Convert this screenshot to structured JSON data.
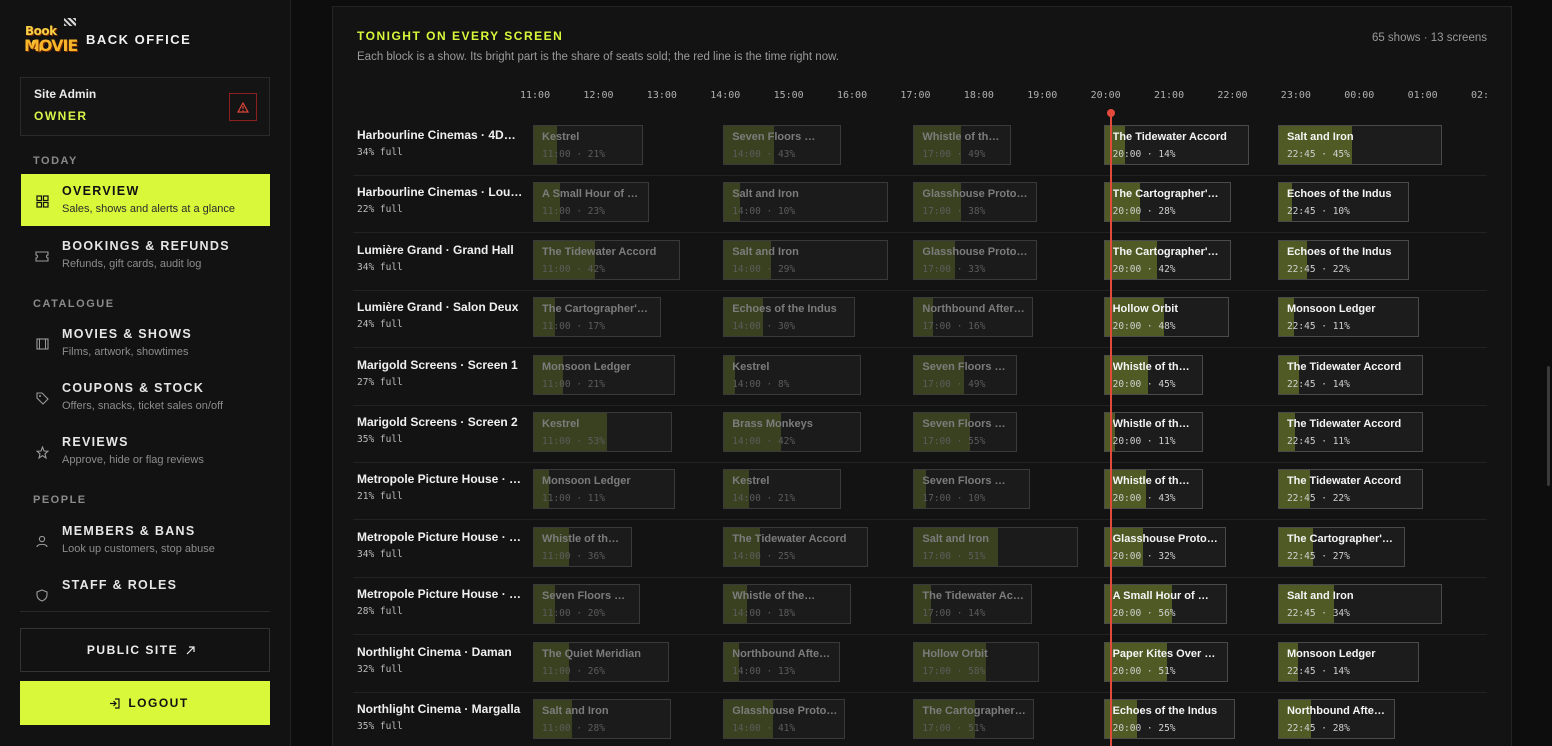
{
  "sidebar": {
    "logo_lines": [
      "Book My",
      "MOVIE"
    ],
    "brand_title": "BACK OFFICE",
    "admin": {
      "name": "Site Admin",
      "role": "OWNER",
      "alert_icon": "warning-triangle-icon"
    },
    "sections": {
      "today": "TODAY",
      "catalogue": "CATALOGUE",
      "people": "PEOPLE"
    },
    "nav": {
      "overview": {
        "title": "OVERVIEW",
        "sub": "Sales, shows and alerts at a glance",
        "icon": "grid-icon"
      },
      "bookings": {
        "title": "BOOKINGS & REFUNDS",
        "sub": "Refunds, gift cards, audit log",
        "icon": "ticket-icon"
      },
      "movies": {
        "title": "MOVIES & SHOWS",
        "sub": "Films, artwork, showtimes",
        "icon": "film-icon"
      },
      "coupons": {
        "title": "COUPONS & STOCK",
        "sub": "Offers, snacks, ticket sales on/off",
        "icon": "tag-icon"
      },
      "reviews": {
        "title": "REVIEWS",
        "sub": "Approve, hide or flag reviews",
        "icon": "star-icon"
      },
      "members": {
        "title": "MEMBERS & BANS",
        "sub": "Look up customers, stop abuse",
        "icon": "user-icon"
      },
      "staff": {
        "title": "STAFF & ROLES",
        "icon": "shield-icon"
      }
    },
    "public_site": "PUBLIC SITE",
    "logout": "LOGOUT"
  },
  "panel": {
    "title": "TONIGHT ON EVERY SCREEN",
    "subtitle": "Each block is a show. Its bright part is the share of seats sold; the red line is the time right now.",
    "stats": "65 shows · 13 screens",
    "ticks": [
      "11:00",
      "12:00",
      "13:00",
      "14:00",
      "15:00",
      "16:00",
      "17:00",
      "18:00",
      "19:00",
      "20:00",
      "21:00",
      "22:00",
      "23:00",
      "00:00",
      "01:00",
      "02:"
    ],
    "now_time": "20:00",
    "colors": {
      "accent": "#d9f83a",
      "now_line": "#e24a3b",
      "sold_fill": "#4f5a24"
    },
    "rows": [
      {
        "venue": "Harbourline Cinemas · 4DX …",
        "fill": "34% full",
        "shows": [
          {
            "title": "Kestrel",
            "meta": "11:00 · 21%",
            "sold": 21
          },
          {
            "title": "Seven Floors …",
            "meta": "14:00 · 43%",
            "sold": 43
          },
          {
            "title": "Whistle of the…",
            "meta": "17:00 · 49%",
            "sold": 49
          },
          {
            "title": "The Tidewater Accord",
            "meta": "20:00 · 14%",
            "sold": 14
          },
          {
            "title": "Salt and Iron",
            "meta": "22:45 · 45%",
            "sold": 45
          }
        ]
      },
      {
        "venue": "Harbourline Cinemas · Lou…",
        "fill": "22% full",
        "shows": [
          {
            "title": "A Small Hour of …",
            "meta": "11:00 · 23%",
            "sold": 23
          },
          {
            "title": "Salt and Iron",
            "meta": "14:00 · 10%",
            "sold": 10
          },
          {
            "title": "Glasshouse Proto…",
            "meta": "17:00 · 38%",
            "sold": 38
          },
          {
            "title": "The Cartographer's…",
            "meta": "20:00 · 28%",
            "sold": 28
          },
          {
            "title": "Echoes of the Indus",
            "meta": "22:45 · 10%",
            "sold": 10
          }
        ]
      },
      {
        "venue": "Lumière Grand · Grand Hall",
        "fill": "34% full",
        "shows": [
          {
            "title": "The Tidewater Accord",
            "meta": "11:00 · 42%",
            "sold": 42
          },
          {
            "title": "Salt and Iron",
            "meta": "14:00 · 29%",
            "sold": 29
          },
          {
            "title": "Glasshouse Proto…",
            "meta": "17:00 · 33%",
            "sold": 33
          },
          {
            "title": "The Cartographer's…",
            "meta": "20:00 · 42%",
            "sold": 42
          },
          {
            "title": "Echoes of the Indus",
            "meta": "22:45 · 22%",
            "sold": 22
          }
        ]
      },
      {
        "venue": "Lumière Grand · Salon Deux",
        "fill": "24% full",
        "shows": [
          {
            "title": "The Cartographer's…",
            "meta": "11:00 · 17%",
            "sold": 17
          },
          {
            "title": "Echoes of the Indus",
            "meta": "14:00 · 30%",
            "sold": 30
          },
          {
            "title": "Northbound After…",
            "meta": "17:00 · 16%",
            "sold": 16
          },
          {
            "title": "Hollow Orbit",
            "meta": "20:00 · 48%",
            "sold": 48
          },
          {
            "title": "Monsoon Ledger",
            "meta": "22:45 · 11%",
            "sold": 11
          }
        ]
      },
      {
        "venue": "Marigold Screens · Screen 1",
        "fill": "27% full",
        "shows": [
          {
            "title": "Monsoon Ledger",
            "meta": "11:00 · 21%",
            "sold": 21
          },
          {
            "title": "Kestrel",
            "meta": "14:00 · 8%",
            "sold": 8
          },
          {
            "title": "Seven Floors …",
            "meta": "17:00 · 49%",
            "sold": 49
          },
          {
            "title": "Whistle of the…",
            "meta": "20:00 · 45%",
            "sold": 45
          },
          {
            "title": "The Tidewater Accord",
            "meta": "22:45 · 14%",
            "sold": 14
          }
        ]
      },
      {
        "venue": "Marigold Screens · Screen 2",
        "fill": "35% full",
        "shows": [
          {
            "title": "Kestrel",
            "meta": "11:00 · 53%",
            "sold": 53
          },
          {
            "title": "Brass Monkeys",
            "meta": "14:00 · 42%",
            "sold": 42
          },
          {
            "title": "Seven Floors …",
            "meta": "17:00 · 55%",
            "sold": 55
          },
          {
            "title": "Whistle of the…",
            "meta": "20:00 · 11%",
            "sold": 11
          },
          {
            "title": "The Tidewater Accord",
            "meta": "22:45 · 11%",
            "sold": 11
          }
        ]
      },
      {
        "venue": "Metropole Picture House · …",
        "fill": "21% full",
        "shows": [
          {
            "title": "Monsoon Ledger",
            "meta": "11:00 · 11%",
            "sold": 11
          },
          {
            "title": "Kestrel",
            "meta": "14:00 · 21%",
            "sold": 21
          },
          {
            "title": "Seven Floors …",
            "meta": "17:00 · 10%",
            "sold": 10
          },
          {
            "title": "Whistle of the…",
            "meta": "20:00 · 43%",
            "sold": 43
          },
          {
            "title": "The Tidewater Accord",
            "meta": "22:45 · 22%",
            "sold": 22
          }
        ]
      },
      {
        "venue": "Metropole Picture House · …",
        "fill": "34% full",
        "shows": [
          {
            "title": "Whistle of the…",
            "meta": "11:00 · 36%",
            "sold": 36
          },
          {
            "title": "The Tidewater Accord",
            "meta": "14:00 · 25%",
            "sold": 25
          },
          {
            "title": "Salt and Iron",
            "meta": "17:00 · 51%",
            "sold": 51
          },
          {
            "title": "Glasshouse Proto…",
            "meta": "20:00 · 32%",
            "sold": 32
          },
          {
            "title": "The Cartographer's…",
            "meta": "22:45 · 27%",
            "sold": 27
          }
        ]
      },
      {
        "venue": "Metropole Picture House · …",
        "fill": "28% full",
        "shows": [
          {
            "title": "Seven Floors …",
            "meta": "11:00 · 20%",
            "sold": 20
          },
          {
            "title": "Whistle of the…",
            "meta": "14:00 · 18%",
            "sold": 18
          },
          {
            "title": "The Tidewater Accord",
            "meta": "17:00 · 14%",
            "sold": 14
          },
          {
            "title": "A Small Hour of …",
            "meta": "20:00 · 56%",
            "sold": 56
          },
          {
            "title": "Salt and Iron",
            "meta": "22:45 · 34%",
            "sold": 34
          }
        ]
      },
      {
        "venue": "Northlight Cinema · Daman",
        "fill": "32% full",
        "shows": [
          {
            "title": "The Quiet Meridian",
            "meta": "11:00 · 26%",
            "sold": 26
          },
          {
            "title": "Northbound After…",
            "meta": "14:00 · 13%",
            "sold": 13
          },
          {
            "title": "Hollow Orbit",
            "meta": "17:00 · 58%",
            "sold": 58
          },
          {
            "title": "Paper Kites Over L…",
            "meta": "20:00 · 51%",
            "sold": 51
          },
          {
            "title": "Monsoon Ledger",
            "meta": "22:45 · 14%",
            "sold": 14
          }
        ]
      },
      {
        "venue": "Northlight Cinema · Margalla",
        "fill": "35% full",
        "shows": [
          {
            "title": "Salt and Iron",
            "meta": "11:00 · 28%",
            "sold": 28
          },
          {
            "title": "Glasshouse Proto…",
            "meta": "14:00 · 41%",
            "sold": 41
          },
          {
            "title": "The Cartographer's…",
            "meta": "17:00 · 51%",
            "sold": 51
          },
          {
            "title": "Echoes of the Indus",
            "meta": "20:00 · 25%",
            "sold": 25
          },
          {
            "title": "Northbound After…",
            "meta": "22:45 · 28%",
            "sold": 28
          }
        ]
      }
    ]
  }
}
